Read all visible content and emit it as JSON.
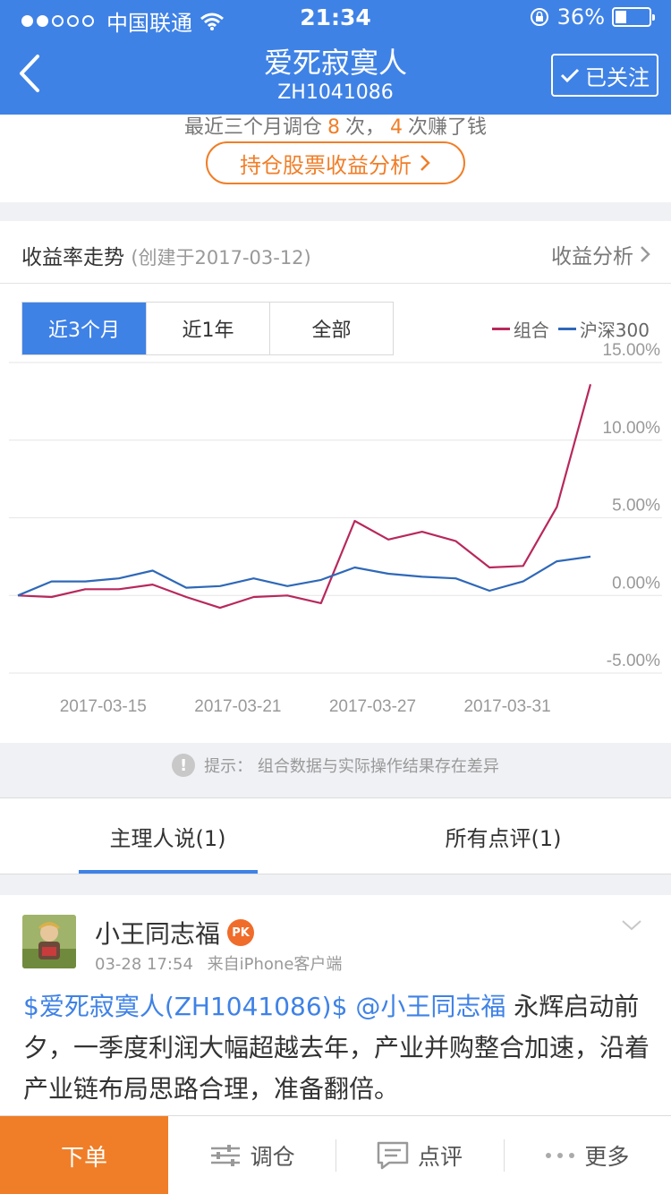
{
  "status_bar": {
    "carrier": "中国联通",
    "time": "21:34",
    "battery": "36%"
  },
  "header": {
    "title": "爱死寂寞人",
    "code": "ZH1041086",
    "follow_label": "已关注"
  },
  "summary": {
    "prefix": "最近三个月调仓",
    "adjust_count": "8",
    "mid": "次，",
    "profit_count": "4",
    "suffix": "次赚了钱",
    "analysis_button": "持仓股票收益分析"
  },
  "trend": {
    "title": "收益率走势",
    "created": "(创建于2017-03-12)",
    "link_label": "收益分析",
    "tabs": [
      "近3个月",
      "近1年",
      "全部"
    ],
    "active_tab": 0
  },
  "notice": "提示：  组合数据与实际操作结果存在差异",
  "comment_tabs": [
    "主理人说(1)",
    "所有点评(1)"
  ],
  "post": {
    "author": "小王同志福",
    "pk_badge": "PK",
    "date": "03-28 17:54",
    "source": "来自iPhone客户端",
    "link1": "$爱死寂寞人(ZH1041086)$",
    "link2": "@小王同志福",
    "text": "永辉启动前夕，一季度利润大幅超越去年，产业并购整合加速，沿着产业链布局思路合理，准备翻倍。"
  },
  "bottom_bar": {
    "order": "下单",
    "adjust": "调仓",
    "comment": "点评",
    "more": "更多"
  },
  "colors": {
    "brand": "#3f82e6",
    "accent": "#f07e28",
    "portfolio": "#b8285c",
    "index": "#2f68b8"
  },
  "chart_data": {
    "type": "line",
    "x": [
      "2017-03-13",
      "2017-03-14",
      "2017-03-15",
      "2017-03-16",
      "2017-03-17",
      "2017-03-20",
      "2017-03-21",
      "2017-03-22",
      "2017-03-23",
      "2017-03-24",
      "2017-03-27",
      "2017-03-28",
      "2017-03-29",
      "2017-03-30",
      "2017-03-31",
      "2017-04-05",
      "2017-04-06",
      "2017-04-07"
    ],
    "x_ticks": [
      "2017-03-15",
      "2017-03-21",
      "2017-03-27",
      "2017-03-31"
    ],
    "series": [
      {
        "name": "组合",
        "color": "#b8285c",
        "values": [
          0.0,
          -0.1,
          0.4,
          0.4,
          0.7,
          -0.1,
          -0.8,
          -0.1,
          0.0,
          -0.5,
          4.8,
          3.6,
          4.1,
          3.5,
          1.8,
          1.9,
          5.7,
          13.6
        ]
      },
      {
        "name": "沪深300",
        "color": "#2f68b8",
        "values": [
          0.0,
          0.9,
          0.9,
          1.1,
          1.6,
          0.5,
          0.6,
          1.1,
          0.6,
          1.0,
          1.8,
          1.4,
          1.2,
          1.1,
          0.3,
          0.9,
          2.2,
          2.5
        ]
      }
    ],
    "y_ticks": [
      "15.00%",
      "10.00%",
      "5.00%",
      "0.00%",
      "-5.00%"
    ],
    "y_tick_values": [
      15,
      10,
      5,
      0,
      -5
    ],
    "ylim": [
      -5,
      15
    ],
    "grid": true,
    "legend": "top-right"
  }
}
